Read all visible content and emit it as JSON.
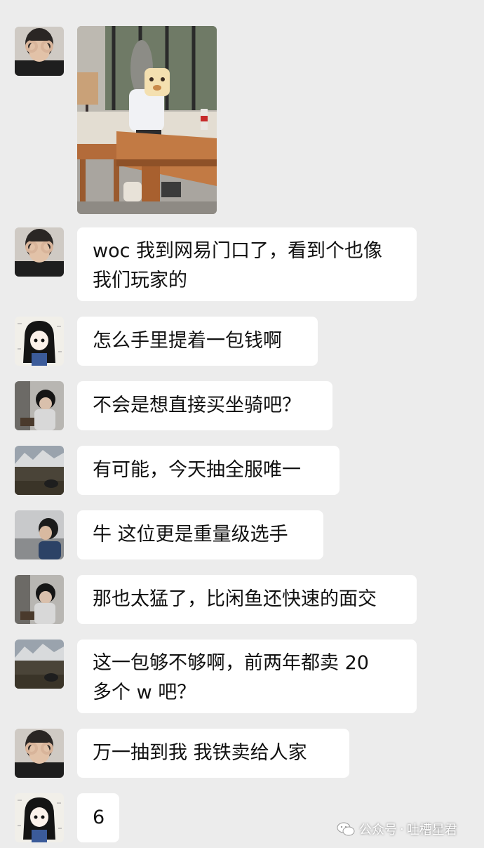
{
  "messages": [
    {
      "sender": "ok-hands-user",
      "type": "image",
      "image_desc": "photo"
    },
    {
      "sender": "ok-hands-user",
      "lines": [
        "woc 我到网易门口了，看到个也像",
        "我们玩家的"
      ]
    },
    {
      "sender": "long-hair-girl",
      "lines": [
        "怎么手里提着一包钱啊"
      ]
    },
    {
      "sender": "dark-hair-guy",
      "lines": [
        "不会是想直接买坐骑吧？"
      ]
    },
    {
      "sender": "mountain-user",
      "lines": [
        "有可能，今天抽全服唯一"
      ]
    },
    {
      "sender": "profile-guy",
      "lines": [
        "牛 这位更是重量级选手"
      ]
    },
    {
      "sender": "dark-hair-guy",
      "lines": [
        "那也太猛了，比闲鱼还快速的面交"
      ]
    },
    {
      "sender": "mountain-user",
      "lines": [
        "这一包够不够啊，前两年都卖 20",
        "多个 w 吧？"
      ]
    },
    {
      "sender": "ok-hands-user",
      "lines": [
        "万一抽到我 我铁卖给人家"
      ]
    },
    {
      "sender": "long-hair-girl",
      "lines": [
        "6"
      ]
    }
  ],
  "watermark": {
    "label": "公众号",
    "separator": "·",
    "account": "吐槽星君"
  },
  "colors": {
    "background": "#ececec",
    "bubble": "#ffffff",
    "text": "#111111"
  }
}
